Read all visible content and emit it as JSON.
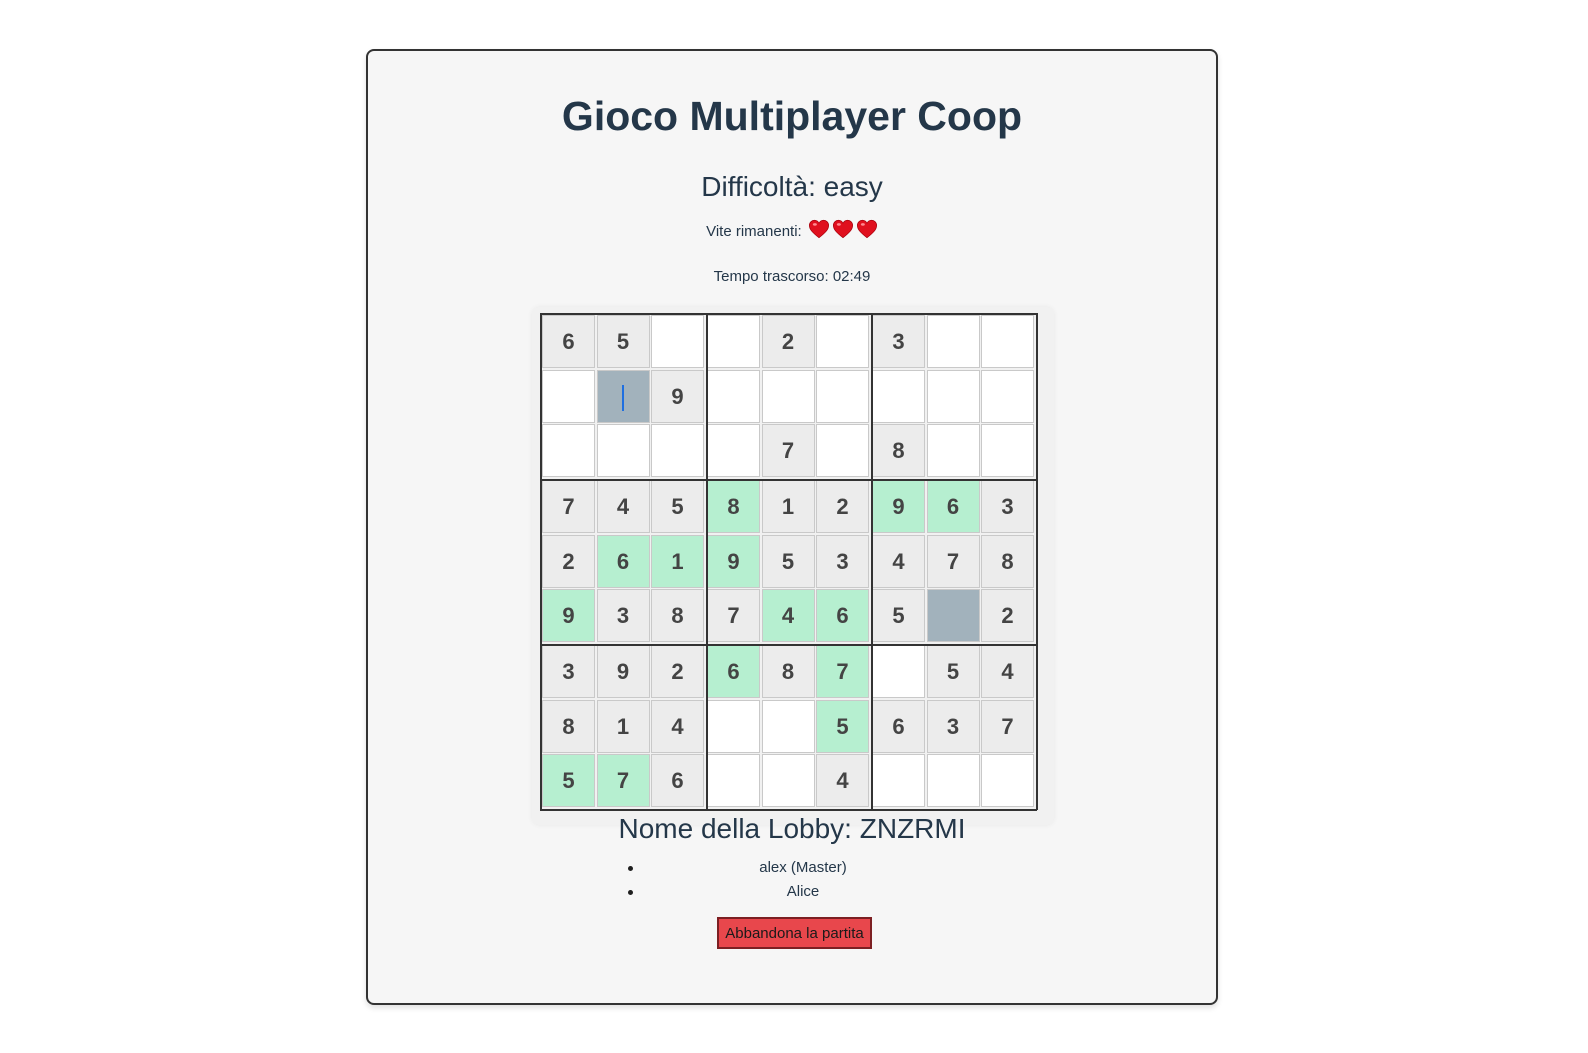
{
  "header": {
    "title": "Gioco Multiplayer Coop",
    "difficulty": "Difficoltà: easy",
    "lives_label": "Vite rimanenti:",
    "lives": 3,
    "timer": "Tempo trascorso: 02:49"
  },
  "board": {
    "rows": [
      [
        "6",
        "5",
        "",
        "",
        "2",
        "",
        "3",
        "",
        ""
      ],
      [
        "",
        "",
        "9",
        "",
        "",
        "",
        "",
        "",
        ""
      ],
      [
        "",
        "",
        "",
        "",
        "7",
        "",
        "8",
        "",
        ""
      ],
      [
        "7",
        "4",
        "5",
        "8",
        "1",
        "2",
        "9",
        "6",
        "3"
      ],
      [
        "2",
        "6",
        "1",
        "9",
        "5",
        "3",
        "4",
        "7",
        "8"
      ],
      [
        "9",
        "3",
        "8",
        "7",
        "4",
        "6",
        "5",
        "",
        "2"
      ],
      [
        "3",
        "9",
        "2",
        "6",
        "8",
        "7",
        "",
        "5",
        "4"
      ],
      [
        "8",
        "1",
        "4",
        "",
        "",
        "5",
        "6",
        "3",
        "7"
      ],
      [
        "5",
        "7",
        "6",
        "",
        "",
        "4",
        "",
        "",
        ""
      ]
    ],
    "states": [
      [
        "given",
        "given",
        "empty",
        "empty",
        "given",
        "empty",
        "given",
        "empty",
        "empty"
      ],
      [
        "empty",
        "selected",
        "given",
        "empty",
        "empty",
        "empty",
        "empty",
        "empty",
        "empty"
      ],
      [
        "empty",
        "empty",
        "empty",
        "empty",
        "given",
        "empty",
        "given",
        "empty",
        "empty"
      ],
      [
        "given",
        "given",
        "given",
        "correct",
        "given",
        "given",
        "correct",
        "correct",
        "given"
      ],
      [
        "given",
        "correct",
        "correct",
        "correct",
        "given",
        "given",
        "given",
        "given",
        "given"
      ],
      [
        "correct",
        "given",
        "given",
        "given",
        "correct",
        "correct",
        "given",
        "selected",
        "given"
      ],
      [
        "given",
        "given",
        "given",
        "correct",
        "given",
        "correct",
        "empty",
        "given",
        "given"
      ],
      [
        "given",
        "given",
        "given",
        "empty",
        "empty",
        "correct",
        "given",
        "given",
        "given"
      ],
      [
        "correct",
        "correct",
        "given",
        "empty",
        "empty",
        "given",
        "empty",
        "empty",
        "empty"
      ]
    ],
    "cursor_cell": [
      1,
      1
    ],
    "colors": {
      "given": "#ececec",
      "empty": "#ffffff",
      "correct": "#b6efd0",
      "selected": "#a2b2bc"
    }
  },
  "lobby": {
    "title": "Nome della Lobby: ZNZRMI",
    "players": [
      "alex (Master)",
      "Alice"
    ]
  },
  "actions": {
    "quit_label": "Abbandona la partita",
    "quit_color": "#e8474c"
  }
}
